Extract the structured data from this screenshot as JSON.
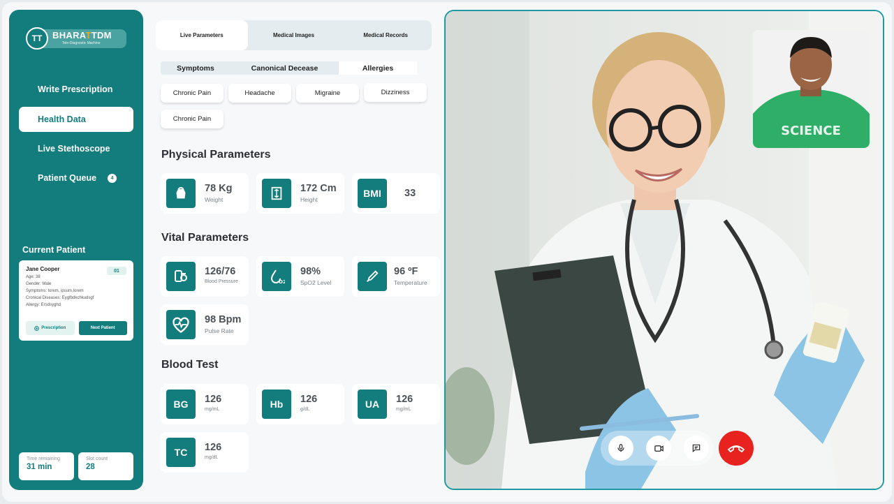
{
  "brand": {
    "initials": "TT",
    "name_part1": "BHARA",
    "name_t1": "T",
    "name_t2": "T",
    "name_part2": "DM",
    "tagline": "Tele-Diagnostic Machine"
  },
  "colors": {
    "primary": "#137c7c",
    "accent_border": "#1f9aa3",
    "end_call": "#e8221f",
    "background": "#f7f8fa"
  },
  "sidebar": {
    "items": [
      {
        "label": "Write Prescription",
        "active": false
      },
      {
        "label": "Health Data",
        "active": true
      },
      {
        "label": "Live Stethoscope",
        "active": false
      },
      {
        "label": "Patient Queue",
        "active": false,
        "badge": "4"
      }
    ],
    "current_patient_title": "Current Patient",
    "patient": {
      "name": "Jane Cooper",
      "number": "01",
      "age": "Age: 38",
      "gender": "Gender: Male",
      "symptoms": "Symptoms: lorem, ipsum,lorem",
      "chronic": "Cronical Diseases: Eygfbdkchkudsgf",
      "allergy": "Allergy: Ersdsyghd",
      "prescription_btn": "Prescription",
      "next_btn": "Next Patient"
    },
    "time_remaining_label": "Time remaining",
    "time_remaining_value": "31 min",
    "slot_count_label": "Slot count",
    "slot_count_value": "28"
  },
  "tabs": [
    {
      "label": "Live Parameters",
      "active": true
    },
    {
      "label": "Medical Images",
      "active": false
    },
    {
      "label": "Medical Records",
      "active": false
    }
  ],
  "subtabs": [
    {
      "label": "Symptoms",
      "active": false
    },
    {
      "label": "Canonical Decease",
      "active": false
    },
    {
      "label": "Allergies",
      "active": true
    }
  ],
  "chips": [
    "Chronic Pain",
    "Headache",
    "Migraine",
    "Dizziness",
    "Chronic Pain"
  ],
  "physical": {
    "title": "Physical Parameters",
    "weight": {
      "value": "78 Kg",
      "label": "Weight",
      "icon": "kettlebell-icon"
    },
    "height": {
      "value": "172 Cm",
      "label": "Height",
      "icon": "ruler-icon"
    },
    "bmi": {
      "badge": "BMI",
      "value": "33"
    }
  },
  "vital": {
    "title": "Vital Parameters",
    "bp": {
      "value": "126/76",
      "label": "Blood Pressure",
      "icon": "blood-pressure-icon"
    },
    "spo2": {
      "value": "98%",
      "label": "SpO2 Level",
      "icon": "oxygen-drop-icon"
    },
    "temp": {
      "value": "96 ºF",
      "label": "Temperature",
      "icon": "thermometer-icon"
    },
    "pulse": {
      "value": "98 Bpm",
      "label": "Pulse Rate",
      "icon": "heartbeat-icon"
    }
  },
  "blood": {
    "title": "Blood Test",
    "bg": {
      "badge": "BG",
      "value": "126",
      "unit": "mg/mL"
    },
    "hb": {
      "badge": "Hb",
      "value": "126",
      "unit": "g/dL"
    },
    "ua": {
      "badge": "UA",
      "value": "126",
      "unit": "mg/mL"
    },
    "tc": {
      "badge": "TC",
      "value": "126",
      "unit": "mg/dL"
    }
  },
  "video": {
    "pip_shirt_text": "SCIENCE",
    "controls": [
      "microphone-icon",
      "camera-icon",
      "chat-icon",
      "end-call-icon"
    ]
  }
}
